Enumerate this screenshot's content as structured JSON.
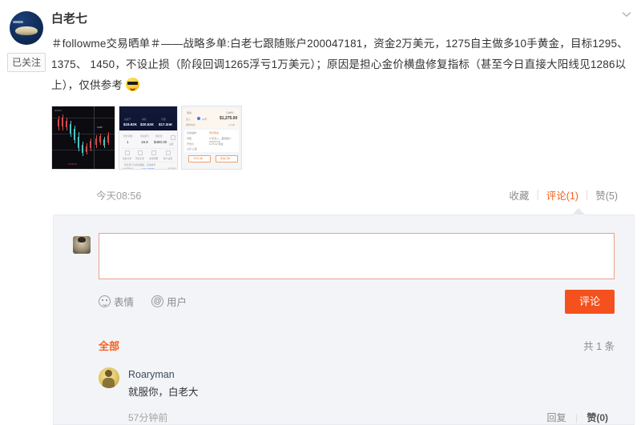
{
  "post": {
    "username": "白老七",
    "follow_label": "已关注",
    "text_line1": "＃followme交易晒单＃——战略多单:白老七跟随账户200047181，资金2万美元，1275自主做多10手黄金，目标1295、1375、",
    "text_line2": "1450，不设止损（阶段回调1265浮亏1万美元）；原因是担心金价横盘修复指标（甚至今日直接大阳线见1286以上），仅供参考",
    "emoji_name": "sunglasses-emoji",
    "timestamp": "今天08:56",
    "thumbnails": [
      {
        "name": "candlestick-chart-thumbnail"
      },
      {
        "name": "trading-app-stats-thumbnail"
      },
      {
        "name": "order-form-thumbnail"
      }
    ],
    "actions": {
      "favorite": "收藏",
      "comment": "评论(1)",
      "like": "赞(5)",
      "divider": "|"
    }
  },
  "compose": {
    "placeholder": "",
    "value": "",
    "emoji_tool": "表情",
    "mention_tool": "用户",
    "mention_icon": "@",
    "submit_label": "评论"
  },
  "comments_section": {
    "filter_all": "全部",
    "total": "共 1 条",
    "items": [
      {
        "name": "Roaryman",
        "text": "就服你，白老大",
        "time": "57分钟前",
        "reply": "回复",
        "like": "赞(0)",
        "divider": "|"
      }
    ]
  },
  "colors": {
    "accent": "#f4601e",
    "button": "#f4511e",
    "panel_bg": "#f3f4f8",
    "input_border": "#e9a08a"
  },
  "icons": {
    "collapse": "chevron-down-icon"
  }
}
